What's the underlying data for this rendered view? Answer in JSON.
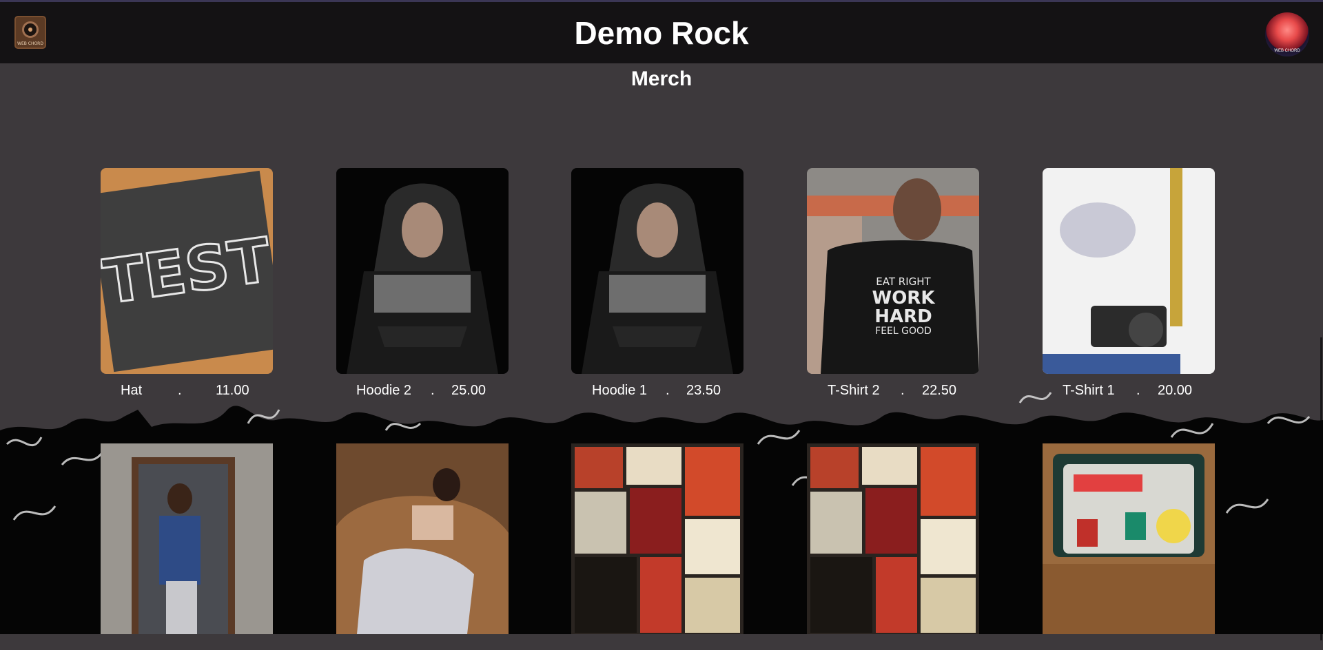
{
  "header": {
    "title": "Demo Rock",
    "logo_text": "WEB CHORD",
    "avatar_text": "WEB CHORD"
  },
  "section": {
    "title": "Merch"
  },
  "products": [
    {
      "name": "Hat",
      "separator": ".",
      "price": "11.00",
      "image": "chalkboard-test"
    },
    {
      "name": "Hoodie 2",
      "separator": ".",
      "price": "25.00",
      "image": "man-in-hoodie"
    },
    {
      "name": "Hoodie 1",
      "separator": ".",
      "price": "23.50",
      "image": "man-in-hoodie"
    },
    {
      "name": "T-Shirt 2",
      "separator": ".",
      "price": "22.50",
      "image": "tshirt-back-print",
      "print_lines": [
        "EAT RIGHT",
        "WORK",
        "HARD",
        "FEEL GOOD"
      ]
    },
    {
      "name": "T-Shirt 1",
      "separator": ".",
      "price": "20.00",
      "image": "white-tshirt-camera"
    }
  ],
  "products_row2": [
    {
      "image": "woman-in-doorway"
    },
    {
      "image": "woman-on-couch"
    },
    {
      "image": "rock-poster-wall"
    },
    {
      "image": "rock-poster-wall"
    },
    {
      "image": "laptop-stickers"
    }
  ],
  "colors": {
    "header_bg": "#141214",
    "page_bg": "#3d393c",
    "text": "#ffffff"
  }
}
